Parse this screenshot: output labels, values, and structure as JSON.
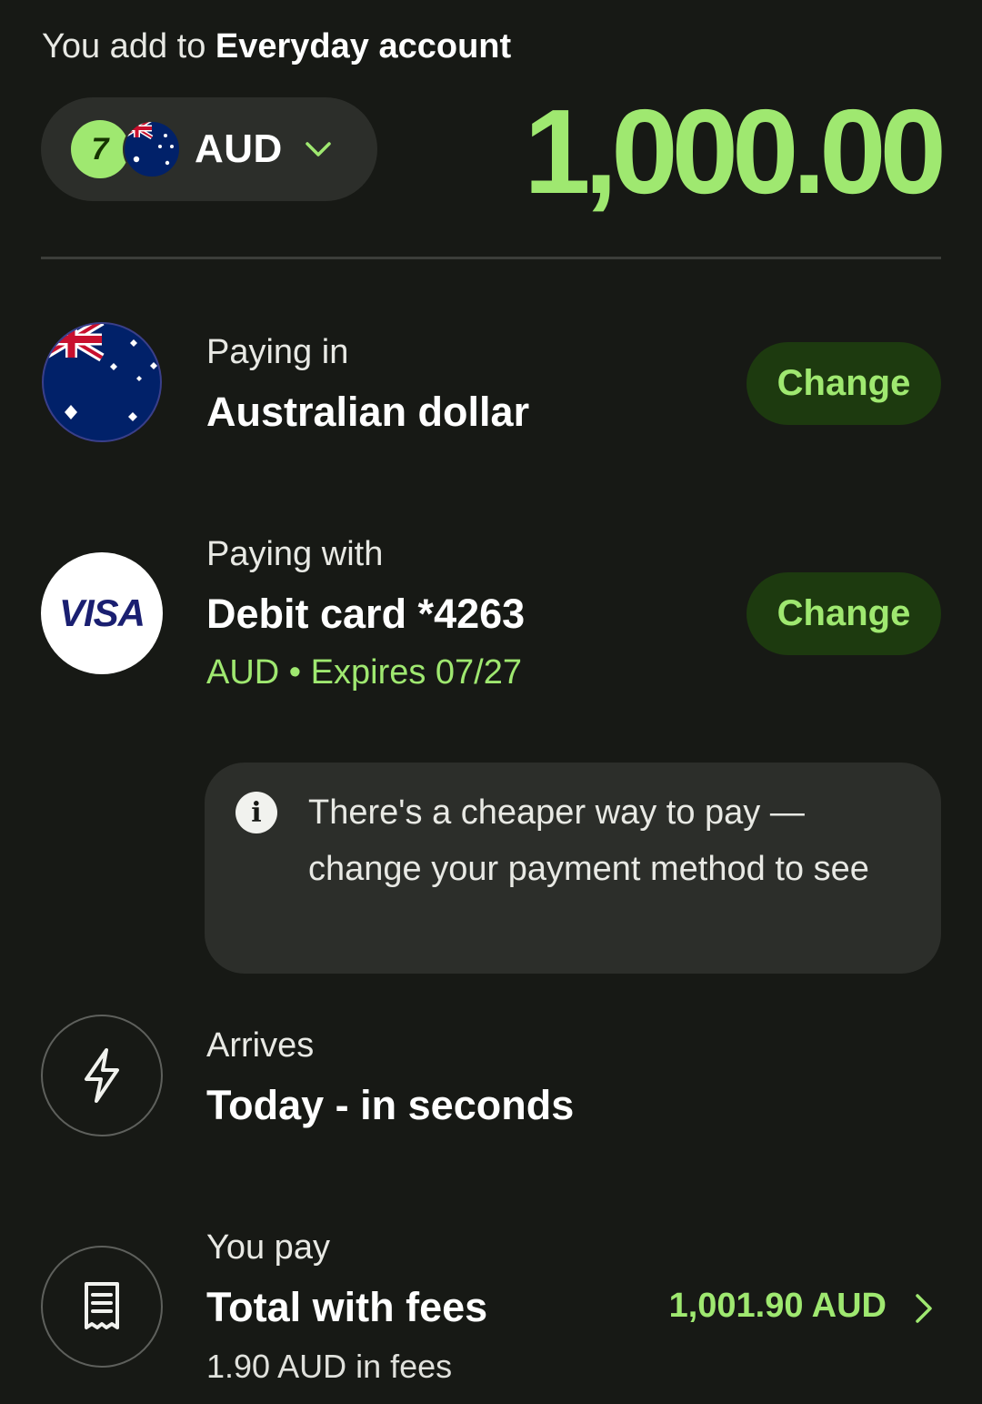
{
  "header": {
    "title_prefix": "You add to ",
    "title_account": "Everyday account"
  },
  "currency_selector": {
    "brand_badge": "7",
    "code": "AUD",
    "icons": [
      "wise-logo",
      "australia-flag",
      "chevron-down"
    ]
  },
  "amount": "1,000.00",
  "paying_in": {
    "label": "Paying in",
    "value": "Australian dollar",
    "button": "Change"
  },
  "paying_with": {
    "label": "Paying with",
    "value": "Debit card *4263",
    "card_brand": "VISA",
    "details": "AUD • Expires 07/27",
    "button": "Change"
  },
  "notice": {
    "icon_glyph": "i",
    "text": "There's a cheaper way to pay — change your payment method to see"
  },
  "arrives": {
    "label": "Arrives",
    "value": "Today - in seconds",
    "icon": "lightning-icon"
  },
  "you_pay": {
    "label": "You pay",
    "value": "Total with fees",
    "fees": "1.90 AUD in fees",
    "total": "1,001.90 AUD",
    "icon": "receipt-icon"
  },
  "colors": {
    "background": "#171915",
    "accent": "#9fe870",
    "button_bg": "#1d3a0f",
    "surface": "#2c2e2a"
  }
}
